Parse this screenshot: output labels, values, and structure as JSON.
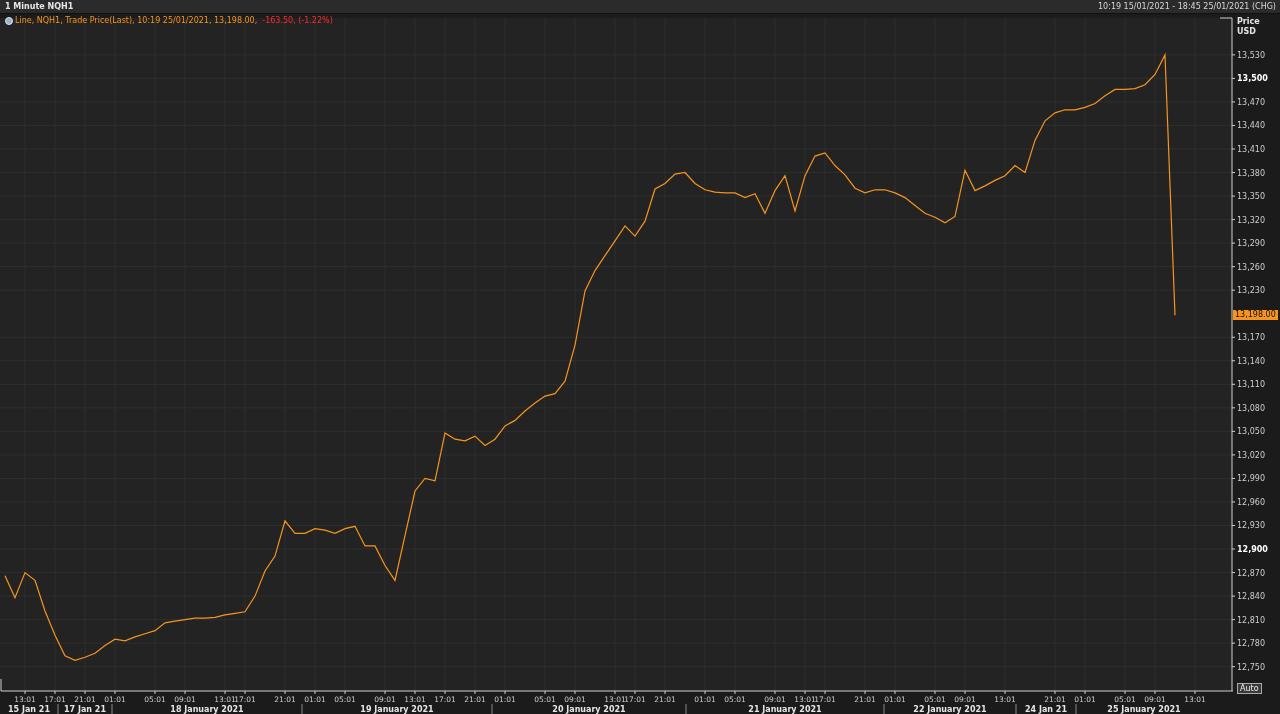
{
  "window": {
    "title": "1 Minute NQH1",
    "range": "10:19 15/01/2021 - 18:45 25/01/2021 (CHG)"
  },
  "legend": {
    "prefix": "Line,",
    "suffix": ", Trade Price(Last), 10:19 25/01/2021, 13,198.00,",
    "change": "-163.50, (-1.22%)"
  },
  "axis": {
    "title": "Price",
    "unit": "USD",
    "last_price": "13,198.00",
    "scale_button": "Auto"
  },
  "date_row": [
    "15 Jan 21",
    "17 Jan 21",
    "18 January 2021",
    "19 January 2021",
    "20 January 2021",
    "21 January 2021",
    "22 January 2021",
    "24 Jan 21",
    "25 January 2021"
  ],
  "chart_data": {
    "type": "line",
    "grid": true,
    "ylim": [
      12719,
      13577
    ],
    "categories": [
      null,
      null,
      "13:01",
      null,
      null,
      "17:01",
      null,
      null,
      "21:01",
      null,
      null,
      "01:01",
      null,
      null,
      null,
      "05:01",
      null,
      null,
      "09:01",
      null,
      null,
      null,
      "13:01",
      null,
      "17:01",
      null,
      null,
      null,
      "21:01",
      null,
      null,
      "01:01",
      null,
      null,
      "05:01",
      null,
      null,
      null,
      "09:01",
      null,
      null,
      "13:01",
      null,
      null,
      "17:01",
      null,
      null,
      "21:01",
      null,
      null,
      "01:01",
      null,
      null,
      null,
      "05:01",
      null,
      null,
      "09:01",
      null,
      null,
      null,
      "13:01",
      null,
      "17:01",
      null,
      null,
      "21:01",
      null,
      null,
      null,
      "01:01",
      null,
      null,
      "05:01",
      null,
      null,
      null,
      "09:01",
      null,
      null,
      "13:01",
      null,
      "17:01",
      null,
      null,
      null,
      "21:01",
      null,
      null,
      "01:01",
      null,
      null,
      null,
      "05:01",
      null,
      null,
      "09:01",
      null,
      null,
      null,
      "13:01",
      null,
      null,
      null,
      null,
      "21:01",
      null,
      null,
      "01:01",
      null,
      null,
      null,
      "05:01",
      null,
      null,
      "09:01",
      null,
      null,
      null,
      "13:01"
    ],
    "series": [
      {
        "name": "NQH1",
        "color": "#f7941d",
        "values": [
          12866,
          12838,
          12870,
          12860,
          12821,
          12790,
          12764,
          12758,
          12762,
          12767,
          12777,
          12785,
          12783,
          12788,
          12792,
          12796,
          12806,
          12808,
          12810,
          12812,
          12812,
          12813,
          12816,
          12818,
          12820,
          12840,
          12872,
          12891,
          12936,
          12920,
          12920,
          12926,
          12924,
          12920,
          12926,
          12929,
          12904,
          12904,
          12879,
          12860,
          12917,
          12974,
          12990,
          12987,
          13048,
          13040,
          13038,
          13044,
          13032,
          13040,
          13057,
          13064,
          13076,
          13086,
          13095,
          13098,
          13114,
          13160,
          13229,
          13255,
          13274,
          13293,
          13312,
          13299,
          13318,
          13359,
          13366,
          13378,
          13380,
          13366,
          13358,
          13355,
          13354,
          13354,
          13348,
          13353,
          13328,
          13357,
          13376,
          13331,
          13376,
          13401,
          13405,
          13389,
          13377,
          13360,
          13354,
          13358,
          13358,
          13354,
          13348,
          13338,
          13328,
          13323,
          13316,
          13324,
          13383,
          13357,
          13363,
          13370,
          13376,
          13389,
          13380,
          13421,
          13446,
          13456,
          13460,
          13460,
          13463,
          13468,
          13478,
          13486,
          13486,
          13487,
          13492,
          13505,
          13530,
          13198,
          null,
          null
        ]
      }
    ],
    "yticks": [
      {
        "value": 13530,
        "label": "13,530"
      },
      {
        "value": 13500,
        "label": "13,500"
      },
      {
        "value": 13470,
        "label": "13,470"
      },
      {
        "value": 13440,
        "label": "13,440"
      },
      {
        "value": 13410,
        "label": "13,410"
      },
      {
        "value": 13380,
        "label": "13,380"
      },
      {
        "value": 13350,
        "label": "13,350"
      },
      {
        "value": 13320,
        "label": "13,320"
      },
      {
        "value": 13290,
        "label": "13,290"
      },
      {
        "value": 13260,
        "label": "13,260"
      },
      {
        "value": 13230,
        "label": "13,230"
      },
      {
        "value": 13170,
        "label": "13,170"
      },
      {
        "value": 13140,
        "label": "13,140"
      },
      {
        "value": 13110,
        "label": "13,110"
      },
      {
        "value": 13080,
        "label": "13,080"
      },
      {
        "value": 13050,
        "label": "13,050"
      },
      {
        "value": 13020,
        "label": "13,020"
      },
      {
        "value": 12990,
        "label": "12,990"
      },
      {
        "value": 12960,
        "label": "12,960"
      },
      {
        "value": 12930,
        "label": "12,930"
      },
      {
        "value": 12900,
        "label": "12,900"
      },
      {
        "value": 12870,
        "label": "12,870"
      },
      {
        "value": 12840,
        "label": "12,840"
      },
      {
        "value": 12810,
        "label": "12,810"
      },
      {
        "value": 12780,
        "label": "12,780"
      },
      {
        "value": 12750,
        "label": "12,750"
      }
    ]
  }
}
